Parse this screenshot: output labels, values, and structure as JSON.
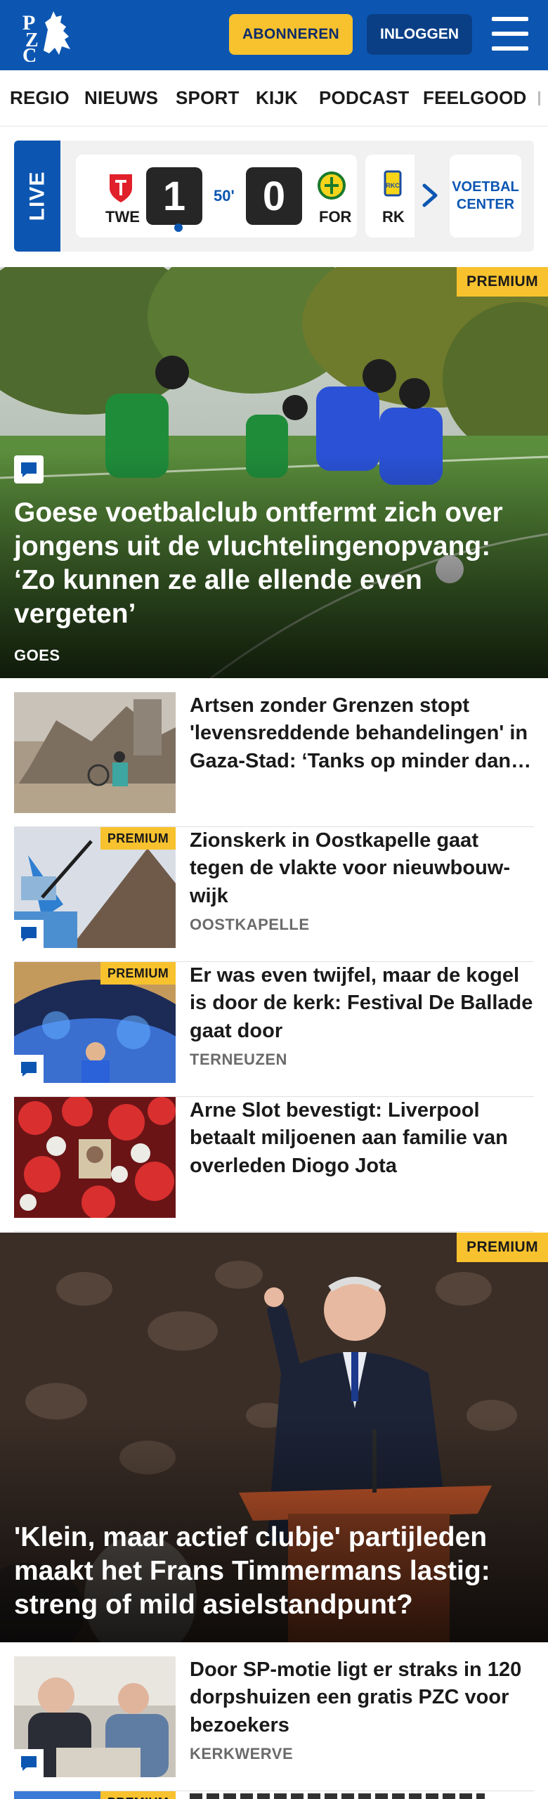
{
  "header": {
    "logo_text": "PZC",
    "subscribe_label": "ABONNEREN",
    "login_label": "INLOGGEN",
    "brand_color": "#0c56b2",
    "accent_color": "#f8c22e"
  },
  "nav": {
    "items": [
      "REGIO",
      "NIEUWS",
      "SPORT",
      "KIJK",
      "PODCAST",
      "FEELGOOD"
    ]
  },
  "live": {
    "label": "LIVE",
    "match": {
      "home_abbr": "TWE",
      "away_abbr": "FOR",
      "home_score": "1",
      "away_score": "0",
      "minute": "50'"
    },
    "next_match_abbr": "RK",
    "center_line1": "VOETBAL",
    "center_line2": "CENTER"
  },
  "hero1": {
    "premium": "PREMIUM",
    "title": "Goese voetbalclub ontfermt zich over jongens uit de vluchtelingenopvang: ‘Zo kunnen ze alle ellende even vergeten’",
    "location": "GOES"
  },
  "articles": [
    {
      "title": "Artsen zonder Grenzen stopt 'levensreddende behandelingen' in Gaza-Stad: ‘Tanks op minder dan een kilometer’",
      "location": "",
      "premium": "",
      "has_comment": false
    },
    {
      "title": "Zionskerk in Oostkapelle gaat tegen de vlakte voor nieuwbouw-wijk",
      "location": "OOSTKAPELLE",
      "premium": "PREMIUM",
      "has_comment": true
    },
    {
      "title": "Er was even twijfel, maar de kogel is door de kerk: Festival De Ballade gaat door",
      "location": "TERNEUZEN",
      "premium": "PREMIUM",
      "has_comment": true
    },
    {
      "title": "Arne Slot bevestigt: Liverpool betaalt miljoenen aan familie van overleden Diogo Jota",
      "location": "",
      "premium": "",
      "has_comment": false
    }
  ],
  "hero2": {
    "premium": "PREMIUM",
    "title": "'Klein, maar actief clubje' partijleden maakt het Frans Timmermans lastig: streng of mild asielstandpunt?"
  },
  "article_last": {
    "title": "Door SP-motie ligt er straks in 120 dorpshuizen een gratis PZC voor bezoekers",
    "location": "KERKWERVE",
    "has_comment": true
  },
  "article_peek": {
    "premium": "PREMIUM"
  }
}
